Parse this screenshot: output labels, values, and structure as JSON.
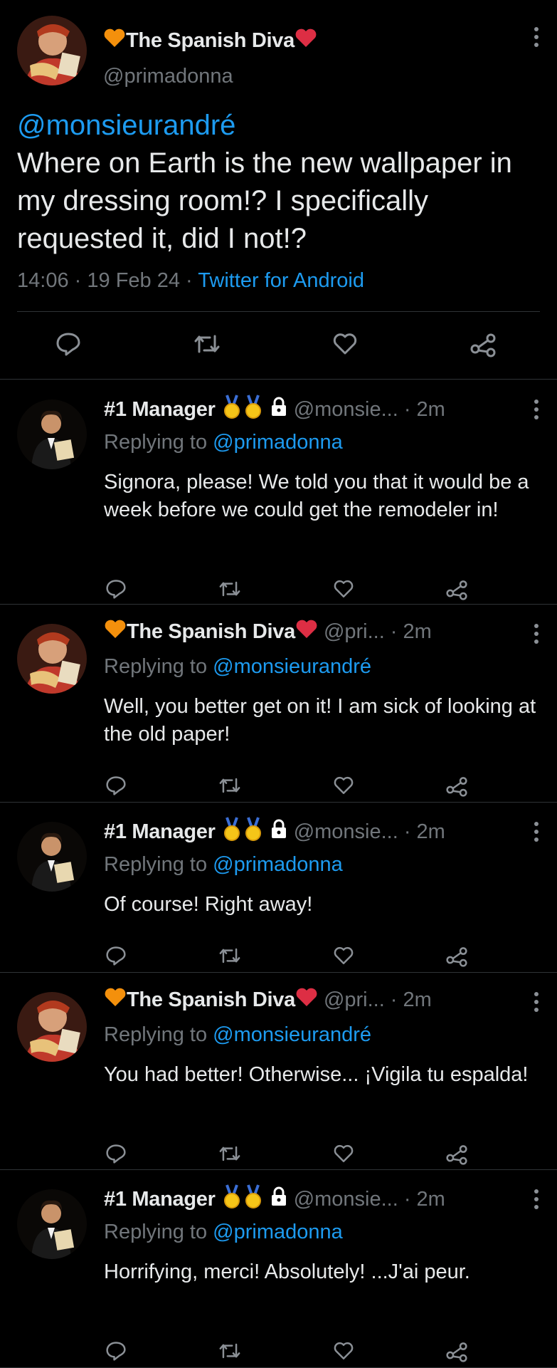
{
  "main_tweet": {
    "display_name": "The Spanish Diva",
    "handle": "@primadonna",
    "mention": "@monsieurandré",
    "text": "Where on Earth is the new wallpaper in my dressing room!? I specifically requested it, did I not!?",
    "time": "14:06",
    "date": "19 Feb 24",
    "source": "Twitter for Android"
  },
  "replies": [
    {
      "display_name": "#1 Manager",
      "handle": "@monsie...",
      "time": "2m",
      "replying_label": "Replying to",
      "replying_to": "@primadonna",
      "text": "Signora, please! We told you that it would be a week before we could get the remodeler in!"
    },
    {
      "display_name": "The Spanish Diva",
      "handle": "@pri...",
      "time": "2m",
      "replying_label": "Replying to",
      "replying_to": "@monsieurandré",
      "text": "Well, you better get on it! I am sick of looking at the old paper!"
    },
    {
      "display_name": "#1 Manager",
      "handle": "@monsie...",
      "time": "2m",
      "replying_label": "Replying to",
      "replying_to": "@primadonna",
      "text": "Of course! Right away!"
    },
    {
      "display_name": "The Spanish Diva",
      "handle": "@pri...",
      "time": "2m",
      "replying_label": "Replying to",
      "replying_to": "@monsieurandré",
      "text": "You had better! Otherwise... ¡Vigila tu espalda!"
    },
    {
      "display_name": "#1 Manager",
      "handle": "@monsie...",
      "time": "2m",
      "replying_label": "Replying to",
      "replying_to": "@primadonna",
      "text": "Horrifying, merci! Absolutely! ...J'ai peur."
    }
  ],
  "separator": "·",
  "icons": [
    "orange-heart-icon",
    "red-heart-icon",
    "medal-icon",
    "lock-icon",
    "reply-icon",
    "retweet-icon",
    "like-icon",
    "share-icon",
    "more-icon"
  ],
  "colors": {
    "background": "#000000",
    "link": "#1d9bf0",
    "secondary_text": "#71767b",
    "divider": "#2f3336"
  }
}
